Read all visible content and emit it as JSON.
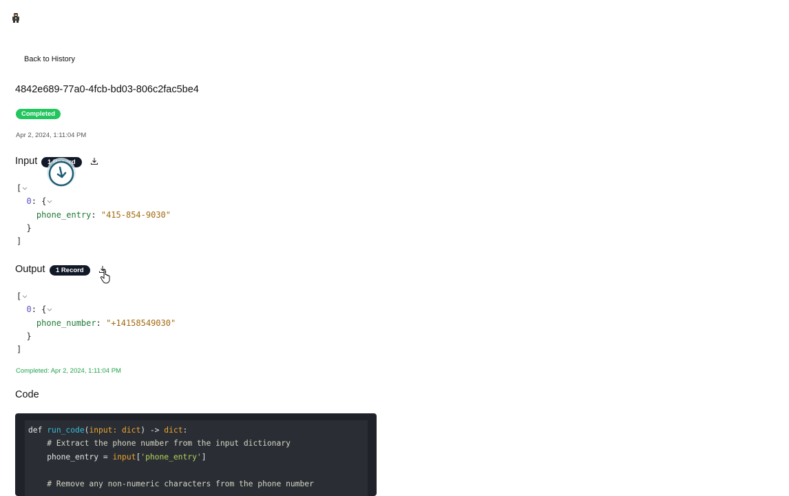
{
  "nav": {
    "back_label": "Back to History"
  },
  "run": {
    "id": "4842e689-77a0-4fcb-bd03-806c2fac5be4",
    "status": "Completed",
    "timestamp": "Apr 2, 2024, 1:11:04 PM",
    "colors": {
      "status_green": "#22c55e",
      "badge_dark": "#111827",
      "code_bg": "#1f2329"
    }
  },
  "input": {
    "title": "Input",
    "badge": "1 Record",
    "download_icon": "download-icon",
    "json": {
      "open": "[",
      "index": "0",
      "brace_open": "{",
      "key": "phone_entry",
      "value": "\"415-854-9030\"",
      "brace_close": "}",
      "close": "]"
    }
  },
  "output": {
    "title": "Output",
    "badge": "1 Record",
    "download_icon": "download-icon",
    "json": {
      "open": "[",
      "index": "0",
      "brace_open": "{",
      "key": "phone_number",
      "value": "\"+14158549030\"",
      "brace_close": "}",
      "close": "]"
    },
    "completed": "Completed: Apr 2, 2024, 1:11:04 PM"
  },
  "code": {
    "title": "Code",
    "lines": {
      "l1_def": "def ",
      "l1_name": "run_code",
      "l1_paren": "(",
      "l1_arg": "input: dict",
      "l1_arrow": ") -> ",
      "l1_ret": "dict",
      "l1_colon": ":",
      "l2": "    # Extract the phone number from the input dictionary",
      "l3_a": "    phone_entry = ",
      "l3_b": "input",
      "l3_c": "[",
      "l3_d": "'phone_entry'",
      "l3_e": "]",
      "l4": "",
      "l5": "    # Remove any non-numeric characters from the phone number"
    }
  }
}
